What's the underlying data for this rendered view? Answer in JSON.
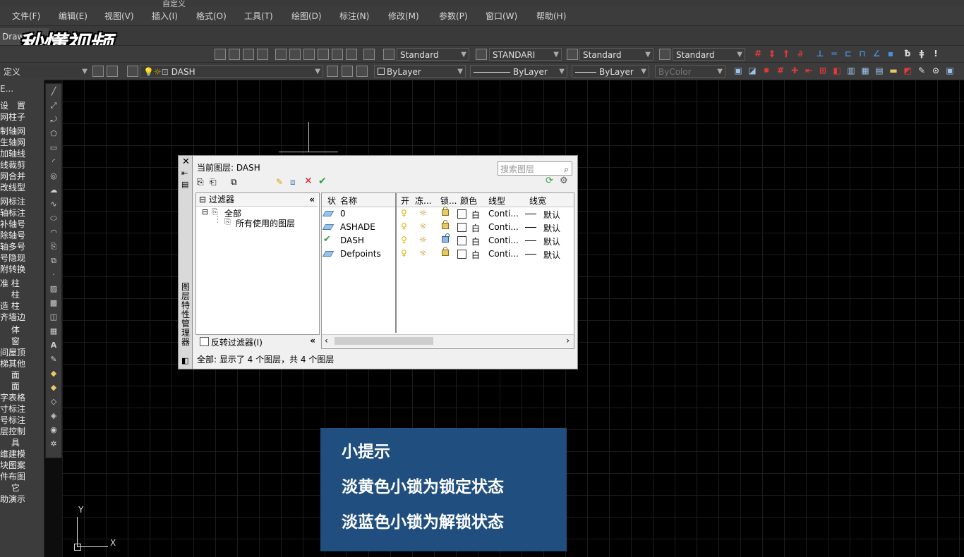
{
  "window": {
    "title_fragment": "自定义"
  },
  "menu": [
    "文件(F)",
    "编辑(E)",
    "视图(V)",
    "插入(I)",
    "格式(O)",
    "工具(T)",
    "绘图(D)",
    "标注(N)",
    "修改(M)",
    "参数(P)",
    "窗口(W)",
    "帮助(H)"
  ],
  "tabs": {
    "draw_tab": "Draw"
  },
  "watermark": {
    "logo_text": "秒懂视频"
  },
  "toolbar1": {
    "text_style": "Standard",
    "dim_style": "STANDARI",
    "table_style": "Standard",
    "multileader_style": "Standard"
  },
  "toolbar2": {
    "workspace": "定义",
    "current_layer": "DASH",
    "color": "ByLayer",
    "linetype": "ByLayer",
    "lineweight": "ByLayer",
    "plot_style": "ByColor"
  },
  "left_panel": {
    "header": "E...",
    "items": [
      "设　置",
      "网柱子",
      "制轴网",
      "生轴网",
      "加轴线",
      "线裁剪",
      "网合并",
      "改线型",
      "网标注",
      "轴标注",
      "补轴号",
      "除轴号",
      "轴多号",
      "号隐现",
      "附转换",
      "准 柱",
      "　 柱",
      "造 柱",
      "齐墙边",
      "　 体",
      "　 窗",
      "间屋顶",
      "梯其他",
      "　 面",
      "　 面",
      "字表格",
      "寸标注",
      "号标注",
      "层控制",
      "　 具",
      "维建模",
      "块图案",
      "件布图",
      "　 它",
      "助演示"
    ]
  },
  "layer_dialog": {
    "current_layer_label": "当前图层: DASH",
    "search_placeholder": "搜索图层",
    "filter_header": "过滤器",
    "tree_root": "全部",
    "tree_child": "所有使用的图层",
    "invert_filter": "反转过滤器(I)",
    "side_title": "图层特性管理器",
    "columns": [
      "状",
      "名称",
      "开",
      "冻...",
      "锁...",
      "颜色",
      "线型",
      "线宽"
    ],
    "layers": [
      {
        "name": "0",
        "color": "白",
        "linetype": "Conti...",
        "lineweight": "默认",
        "locked": true,
        "current": false
      },
      {
        "name": "ASHADE",
        "color": "白",
        "linetype": "Conti...",
        "lineweight": "默认",
        "locked": true,
        "current": false
      },
      {
        "name": "DASH",
        "color": "白",
        "linetype": "Conti...",
        "lineweight": "默认",
        "locked": false,
        "current": true
      },
      {
        "name": "Defpoints",
        "color": "白",
        "linetype": "Conti...",
        "lineweight": "默认",
        "locked": true,
        "current": false
      }
    ],
    "status": "全部: 显示了 4 个图层，共 4 个图层"
  },
  "tip": {
    "title": "小提示",
    "line1": "淡黄色小锁为锁定状态",
    "line2": "淡蓝色小锁为解锁状态"
  },
  "ucs": {
    "x": "X",
    "y": "Y"
  },
  "colors": {
    "tip_bg": "#1f4e7f",
    "locked_lock": "#e7c968",
    "unlocked_lock": "#8fbbe3",
    "current_check": "#2e9e3e"
  }
}
